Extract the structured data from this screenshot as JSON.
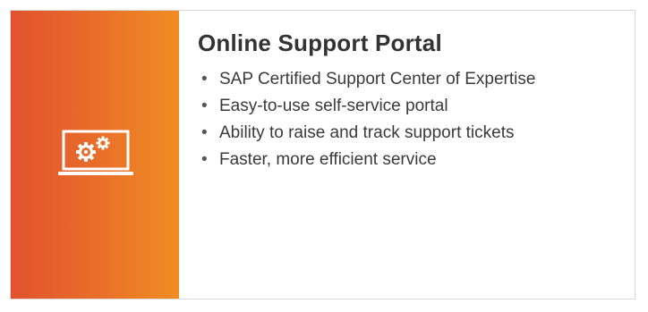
{
  "card": {
    "title": "Online Support Portal",
    "icon": "laptop-gears-icon",
    "bullet_glyph": "•",
    "bullets": [
      "SAP Certified Support Center of Expertise",
      "Easy-to-use self-service portal",
      "Ability to raise and track support tickets",
      "Faster, more efficient service"
    ]
  },
  "colors": {
    "accent_start": "#e1522e",
    "accent_end": "#f08d22",
    "title": "#333333",
    "text": "#3a3a3a"
  }
}
